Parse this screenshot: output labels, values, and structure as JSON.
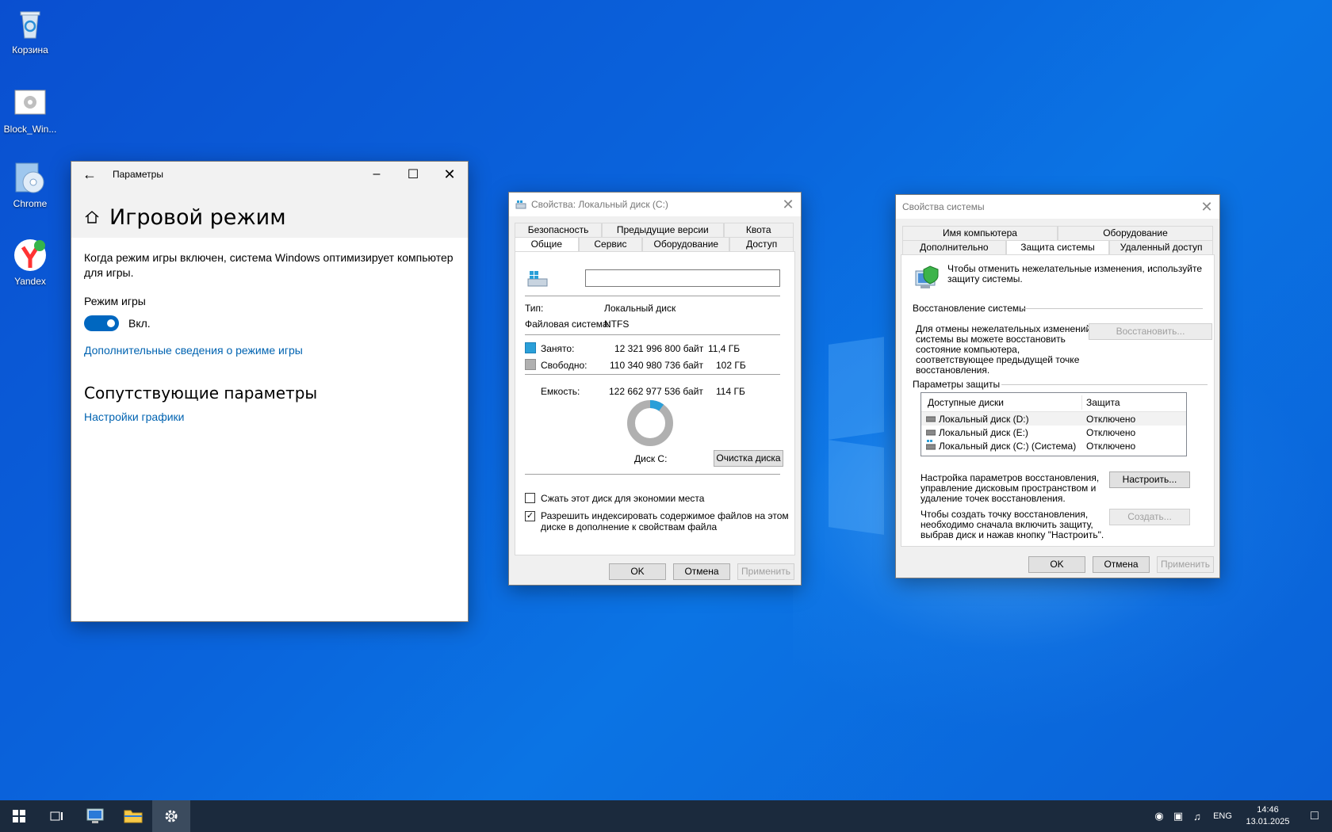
{
  "desktop": {
    "icons": [
      {
        "label": "Корзина"
      },
      {
        "label": "Block_Win..."
      },
      {
        "label": "Chrome"
      },
      {
        "label": "Yandex"
      }
    ]
  },
  "settings": {
    "title": "Параметры",
    "page_title": "Игровой режим",
    "description": "Когда режим игры включен, система Windows оптимизирует компьютер для игры.",
    "game_mode_label": "Режим игры",
    "toggle_state": "Вкл.",
    "more_info_link": "Дополнительные сведения о режиме игры",
    "related_title": "Сопутствующие параметры",
    "graphics_link": "Настройки графики"
  },
  "disk_props": {
    "title": "Свойства: Локальный диск (C:)",
    "tabs_row1": [
      "Безопасность",
      "Предыдущие версии",
      "Квота"
    ],
    "tabs_row2": [
      "Общие",
      "Сервис",
      "Оборудование",
      "Доступ"
    ],
    "name_value": "",
    "type_label": "Тип:",
    "type_value": "Локальный диск",
    "fs_label": "Файловая система:",
    "fs_value": "NTFS",
    "used_label": "Занято:",
    "used_bytes": "12 321 996 800 байт",
    "used_gb": "11,4 ГБ",
    "free_label": "Свободно:",
    "free_bytes": "110 340 980 736 байт",
    "free_gb": "102 ГБ",
    "capacity_label": "Емкость:",
    "capacity_bytes": "122 662 977 536 байт",
    "capacity_gb": "114 ГБ",
    "used_fraction": 0.1,
    "disk_label": "Диск C:",
    "cleanup_button": "Очистка диска",
    "compress_label": "Сжать этот диск для экономии места",
    "index_label_1": "Разрешить индексировать содержимое файлов на этом",
    "index_label_2": "диске в дополнение к свойствам файла",
    "ok": "OK",
    "cancel": "Отмена",
    "apply": "Применить",
    "colors": {
      "used": "#2a9fd8",
      "free": "#b0b0b0"
    }
  },
  "sys_props": {
    "title": "Свойства системы",
    "tabs_row1": [
      "Имя компьютера",
      "Оборудование"
    ],
    "tabs_row2": [
      "Дополнительно",
      "Защита системы",
      "Удаленный доступ"
    ],
    "intro_1": "Чтобы отменить нежелательные изменения, используйте",
    "intro_2": "защиту системы.",
    "restore_group": "Восстановление системы",
    "restore_text_1": "Для отмены нежелательных изменений",
    "restore_text_2": "системы вы можете восстановить",
    "restore_text_3": "состояние компьютера,",
    "restore_text_4": "соответствующее предыдущей точке",
    "restore_text_5": "восстановления.",
    "restore_button": "Восстановить...",
    "protection_group": "Параметры защиты",
    "col_drives": "Доступные диски",
    "col_protection": "Защита",
    "drives": [
      {
        "name": "Локальный диск (D:)",
        "status": "Отключено"
      },
      {
        "name": "Локальный диск (E:)",
        "status": "Отключено"
      },
      {
        "name": "Локальный диск (C:) (Система)",
        "status": "Отключено"
      }
    ],
    "config_text_1": "Настройка параметров восстановления,",
    "config_text_2": "управление дисковым пространством и",
    "config_text_3": "удаление точек восстановления.",
    "config_button": "Настроить...",
    "create_text_1": "Чтобы создать точку восстановления,",
    "create_text_2": "необходимо сначала включить защиту,",
    "create_text_3": "выбрав диск и нажав кнопку \"Настроить\".",
    "create_button": "Создать...",
    "ok": "OK",
    "cancel": "Отмена",
    "apply": "Применить"
  },
  "taskbar": {
    "language": "ENG",
    "time": "14:46",
    "date": "13.01.2025"
  }
}
